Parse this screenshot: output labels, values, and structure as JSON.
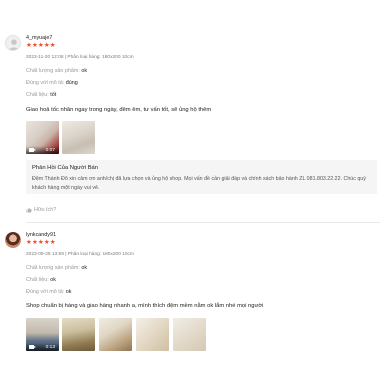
{
  "reviews": [
    {
      "username": "4_myuaje7",
      "stars": "★★★★★",
      "meta": "2023-11-20 12:08 | Phân loại hàng: 180x200 10cm",
      "attributes": [
        {
          "key": "Chất lượng sản phẩm:",
          "value": "ok"
        },
        {
          "key": "Đúng với mô tả:",
          "value": "đúng"
        },
        {
          "key": "Chất liệu:",
          "value": "tốt"
        }
      ],
      "comment": "Giao hoả tốc nhân ngay trong ngày, đêm êm, tư vấn tốt, sẽ ủng hộ thêm",
      "media": [
        {
          "type": "video",
          "duration": "0:07"
        },
        {
          "type": "image"
        }
      ],
      "seller_reply": {
        "title": "Phản Hồi Của Người Bán",
        "text": "Đệm Thành Đô xin cảm ơn anh/chị đã lựa chọn và ủng hộ shop. Mọi vấn đề cần giải đáp và chính sách bảo hành ZL 081.803.22.22. Chúc quý khách hàng một ngày vui vẻ."
      },
      "helpful_label": "Hữu ích?"
    },
    {
      "username": "lynkcandy91",
      "stars": "★★★★★",
      "meta": "2023-09-25 13:59 | Phân loại hàng: 180x200 10cm",
      "attributes": [
        {
          "key": "Chất lượng sản phẩm:",
          "value": "ok"
        },
        {
          "key": "Chất liệu:",
          "value": "ok"
        },
        {
          "key": "Đúng với mô tả:",
          "value": "ok"
        }
      ],
      "comment": "Shop chuẩn bị hàng và giao hàng nhanh a, mình thích đệm mềm nằm ok lắm nhé mọi người",
      "media": [
        {
          "type": "video",
          "duration": "0:13"
        },
        {
          "type": "image"
        },
        {
          "type": "image"
        },
        {
          "type": "image"
        },
        {
          "type": "image"
        }
      ]
    }
  ],
  "colors": {
    "star": "#ee4d2d",
    "reply_bg": "#f5f5f5",
    "muted": "#9a9a9a"
  }
}
